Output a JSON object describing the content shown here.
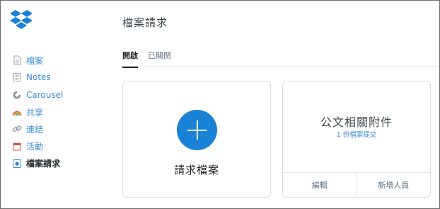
{
  "sidebar": {
    "items": [
      {
        "label": "檔案",
        "icon": "file-icon"
      },
      {
        "label": "Notes",
        "icon": "notes-icon"
      },
      {
        "label": "Carousel",
        "icon": "carousel-icon"
      },
      {
        "label": "共享",
        "icon": "rainbow-share-icon"
      },
      {
        "label": "連結",
        "icon": "link-icon"
      },
      {
        "label": "活動",
        "icon": "calendar-icon"
      },
      {
        "label": "檔案請求",
        "icon": "file-request-icon",
        "active": true
      }
    ]
  },
  "main": {
    "title": "檔案請求",
    "tabs": [
      {
        "label": "開啟",
        "active": true
      },
      {
        "label": "已關閉",
        "active": false
      }
    ],
    "new_request": {
      "label": "請求檔案"
    },
    "request_card": {
      "title": "公文相關附件",
      "subtitle": "1 份檔案提交",
      "actions": [
        "編輯",
        "新增人員"
      ]
    }
  },
  "colors": {
    "accent": "#1a82d6",
    "link": "#3b8ed9",
    "dropbox_logo": "#0061fe"
  }
}
